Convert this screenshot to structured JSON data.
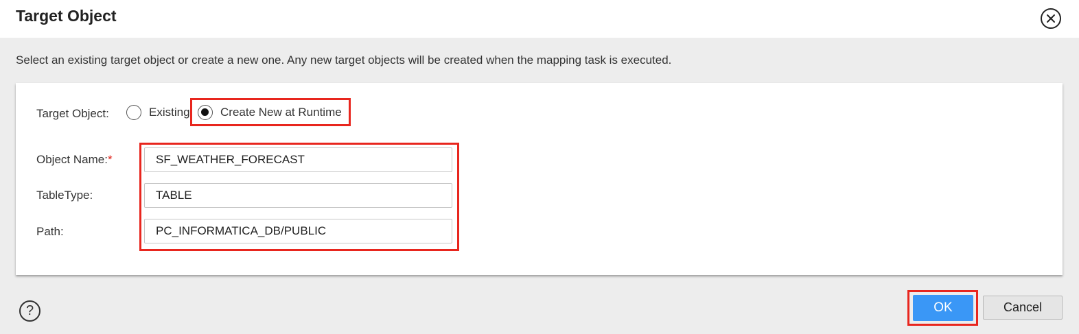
{
  "dialog": {
    "title": "Target Object",
    "description": "Select an existing target object or create a new one. Any new target objects will be created when the mapping task is executed."
  },
  "form": {
    "target_object_label": "Target Object:",
    "options": [
      {
        "label": "Existing",
        "selected": false
      },
      {
        "label": "Create New at Runtime",
        "selected": true
      }
    ],
    "object_name_label": "Object Name:",
    "object_name_required": "*",
    "object_name_value": "SF_WEATHER_FORECAST",
    "table_type_label": "TableType:",
    "table_type_value": "TABLE",
    "path_label": "Path:",
    "path_value": "PC_INFORMATICA_DB/PUBLIC"
  },
  "footer": {
    "help_icon": "?",
    "ok_label": "OK",
    "cancel_label": "Cancel"
  },
  "colors": {
    "highlight": "#e8261e",
    "primary_button": "#3a97f6"
  }
}
